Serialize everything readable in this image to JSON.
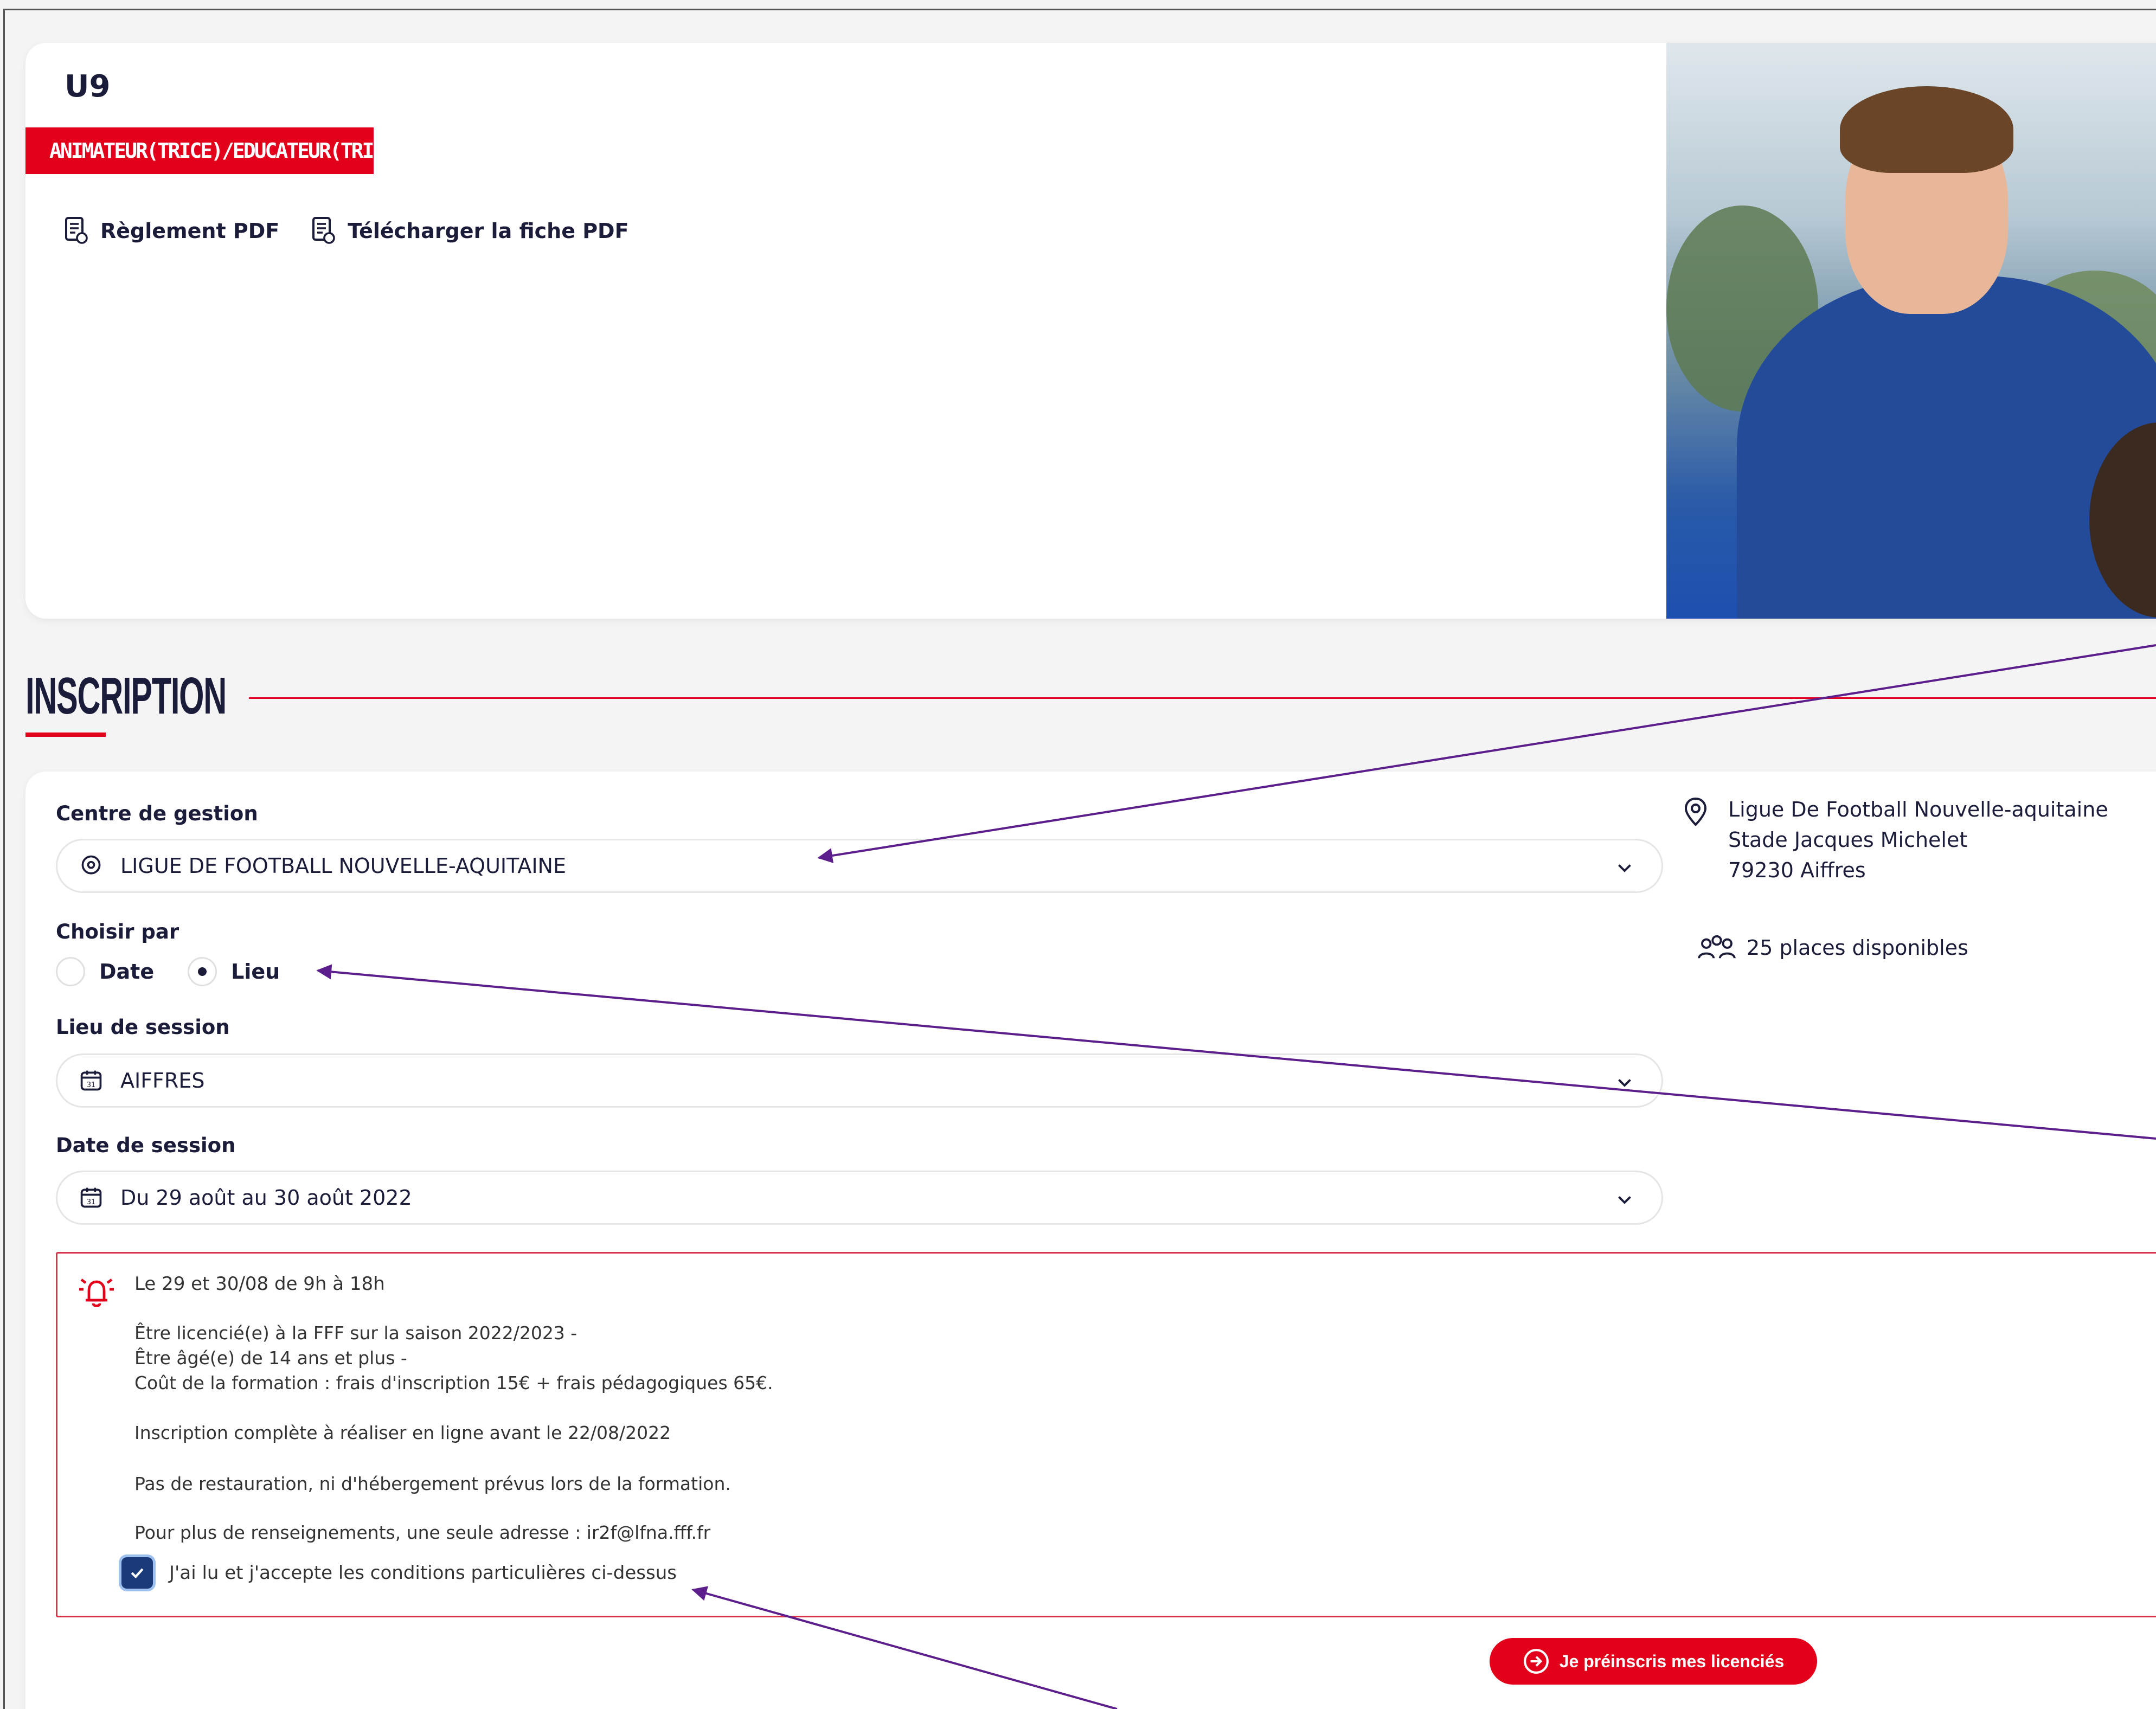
{
  "hero": {
    "title": "U9",
    "tag": "ANIMATEUR(TRICE)/EDUCATEUR(TRICE)",
    "links": [
      {
        "label": "Règlement PDF",
        "icon": "pdf-document-icon"
      },
      {
        "label": "Télécharger la fiche PDF",
        "icon": "pdf-document-icon"
      }
    ]
  },
  "inscription": {
    "title": "INSCRIPTION",
    "centre": {
      "label": "Centre de gestion",
      "value": "LIGUE DE FOOTBALL NOUVELLE-AQUITAINE",
      "icon": "location-pin-icon"
    },
    "choose_by": {
      "label": "Choisir par",
      "options": [
        {
          "label": "Date",
          "checked": false
        },
        {
          "label": "Lieu",
          "checked": true
        }
      ]
    },
    "lieu": {
      "label": "Lieu de session",
      "value": "AIFFRES",
      "icon": "calendar-icon"
    },
    "date": {
      "label": "Date de session",
      "value": "Du 29 août au 30 août 2022",
      "icon": "calendar-icon"
    },
    "address": {
      "lines": [
        "Ligue De Football Nouvelle-aquitaine",
        "Stade Jacques Michelet",
        "79230 Aiffres"
      ],
      "icon": "location-pin-icon"
    },
    "places": {
      "text": "25 places disponibles",
      "icon": "people-icon"
    },
    "conditions": {
      "icon": "alarm-bell-icon",
      "title": "Le 29 et 30/08 de 9h à 18h",
      "lines": [
        "Être licencié(e) à la FFF sur la saison 2022/2023 -",
        "Être âgé(e) de 14 ans et plus -",
        "Coût de la formation : frais d'inscription 15€ + frais pédagogiques 65€.",
        "Inscription complète à réaliser en ligne avant le 22/08/2022",
        "Pas de restauration, ni d'hébergement prévus lors de la formation.",
        "Pour plus de renseignements, une seule adresse : ir2f@lfna.fff.fr"
      ],
      "accept_label": "J'ai lu et j'accepte les conditions particulières ci-dessus",
      "accepted": true
    },
    "submit_label": "Je préinscris mes licenciés"
  },
  "colors": {
    "accent": "#e2001a",
    "navy": "#1b1b3a",
    "annotation": "#5b1e8c"
  }
}
